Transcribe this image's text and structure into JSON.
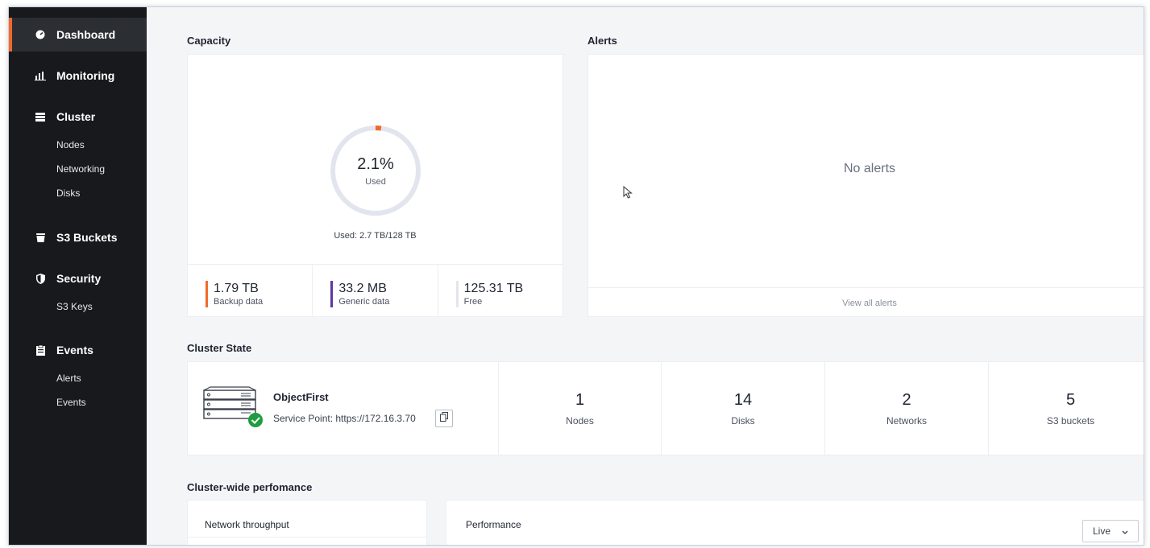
{
  "sidebar": {
    "items": [
      {
        "label": "Dashboard",
        "icon": "dashboard-icon"
      },
      {
        "label": "Monitoring",
        "icon": "bar-chart-icon"
      },
      {
        "label": "Cluster",
        "icon": "server-stack-icon",
        "children": [
          "Nodes",
          "Networking",
          "Disks"
        ]
      },
      {
        "label": "S3 Buckets",
        "icon": "bucket-icon"
      },
      {
        "label": "Security",
        "icon": "shield-icon",
        "children": [
          "S3 Keys"
        ]
      },
      {
        "label": "Events",
        "icon": "clipboard-icon",
        "children": [
          "Alerts",
          "Events"
        ]
      }
    ]
  },
  "capacity": {
    "title": "Capacity",
    "percent": "2.1%",
    "percent_label": "Used",
    "used_fraction": 0.021,
    "used_line": "Used: 2.7 TB/128 TB",
    "stats": [
      {
        "value": "1.79 TB",
        "label": "Backup data",
        "color": "#ef6a2a"
      },
      {
        "value": "33.2 MB",
        "label": "Generic data",
        "color": "#5b3aa0"
      },
      {
        "value": "125.31 TB",
        "label": "Free",
        "color": "#e2e5ea"
      }
    ]
  },
  "alerts": {
    "title": "Alerts",
    "empty_text": "No alerts",
    "view_all": "View all alerts"
  },
  "cluster_state": {
    "title": "Cluster State",
    "name": "ObjectFirst",
    "service_point": "Service Point:  https://172.16.3.70",
    "metrics": [
      {
        "value": "1",
        "label": "Nodes"
      },
      {
        "value": "14",
        "label": "Disks"
      },
      {
        "value": "2",
        "label": "Networks"
      },
      {
        "value": "5",
        "label": "S3 buckets"
      }
    ]
  },
  "performance": {
    "title": "Cluster-wide perfomance",
    "network_throughput": "Network throughput",
    "performance_label": "Performance",
    "live_label": "Live"
  },
  "colors": {
    "accent": "#ef6a2a",
    "sidebar_bg": "#17191c",
    "ok_green": "#1f9d3f"
  }
}
